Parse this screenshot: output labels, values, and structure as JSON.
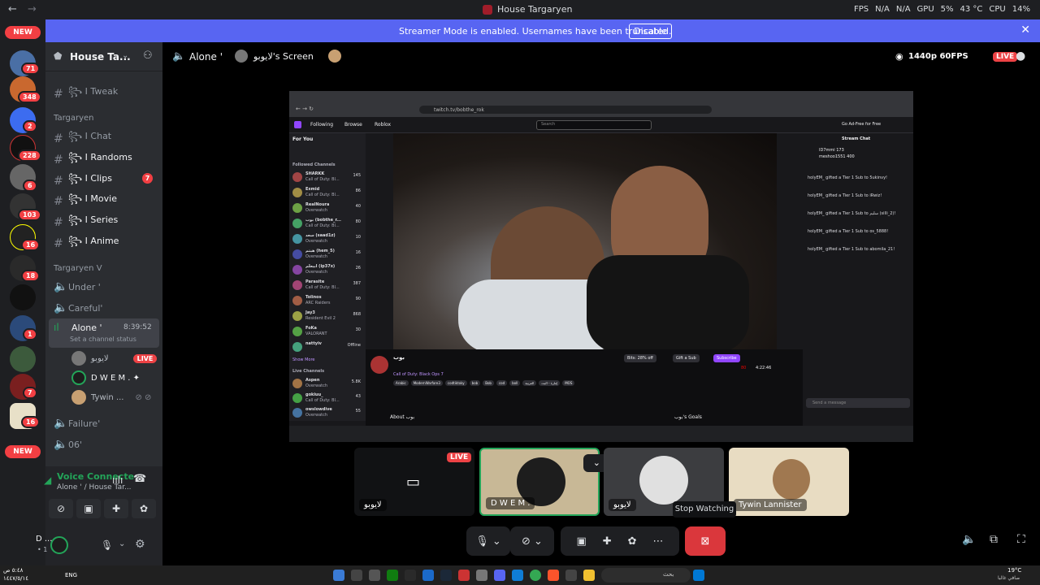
{
  "window": {
    "title": "House Targaryen"
  },
  "stats": {
    "fps_label": "FPS",
    "fps": "N/A",
    "fps2": "N/A",
    "gpu_label": "GPU",
    "gpu": "5%",
    "temp": "43 °C",
    "cpu_label": "CPU",
    "cpu": "14%"
  },
  "banner": {
    "text": "Streamer Mode is enabled. Usernames have been truncated.",
    "button": "Disable"
  },
  "rail": {
    "badges": [
      "71",
      "348",
      "2",
      "228",
      "6",
      "103",
      "16",
      "18",
      "1",
      "7",
      "16"
    ],
    "new_top": "NEW",
    "new_bottom": "NEW"
  },
  "sidebar": {
    "server_name": "House Ta...",
    "channels_top": [
      {
        "label": "꧂ I Tweak"
      }
    ],
    "category1": "Targaryen",
    "channels": [
      {
        "label": "꧂ I Chat"
      },
      {
        "label": "꧂ I Randoms"
      },
      {
        "label": "꧂ I Clips",
        "mentions": "7"
      },
      {
        "label": "꧂ I Movie"
      },
      {
        "label": "꧂ I Series"
      },
      {
        "label": "꧂ I Anime"
      }
    ],
    "category2": "Targaryen V",
    "voice": [
      {
        "label": "Under '"
      },
      {
        "label": "Careful'"
      },
      {
        "label": "Alone '",
        "timer": "8:39:52",
        "status": "Set a channel status"
      }
    ],
    "voice_users": [
      {
        "name": "لايوبو",
        "live": "LIVE"
      },
      {
        "name": "D W E M . ✦"
      },
      {
        "name": "Tywin ..."
      }
    ],
    "voice_after": [
      {
        "label": "Failure'"
      },
      {
        "label": "06'"
      }
    ]
  },
  "voice_panel": {
    "status": "Voice Connecte",
    "sub": "Alone ' / House Tar..."
  },
  "user_panel": {
    "name": "D ...",
    "sub": "• 1"
  },
  "stage": {
    "channel": "Alone '",
    "screen_title": "لايوبو's Screen",
    "quality": "1440p 60FPS",
    "live": "LIVE",
    "tooltip": "Stop Watching"
  },
  "twitch": {
    "url": "twitch.tv/bobthe_rok",
    "nav": [
      "Following",
      "Browse",
      "Roblox"
    ],
    "search_placeholder": "Search",
    "for_you": "For You",
    "followed": "Followed Channels",
    "ad_free": "Go Ad-Free for Free",
    "stream_chat": "Stream Chat",
    "channels": [
      {
        "name": "SHARKK",
        "game": "Call of Duty: Bl...",
        "viewers": "145"
      },
      {
        "name": "Exmid",
        "game": "Call of Duty: Bl...",
        "viewers": "86"
      },
      {
        "name": "RealNoura",
        "game": "Overwatch",
        "viewers": "40"
      },
      {
        "name": "بوب (bobthe_r...",
        "game": "Call of Duty: Bl...",
        "viewers": "80"
      },
      {
        "name": "سعد (saad1z)",
        "game": "Overwatch",
        "viewers": "10"
      },
      {
        "name": "هيثم (hem_5)",
        "game": "Overwatch",
        "viewers": "16"
      },
      {
        "name": "ابيعلم (ip37x)",
        "game": "Overwatch",
        "viewers": "26"
      },
      {
        "name": "Parasite",
        "game": "Call of Duty: Bl...",
        "viewers": "387"
      },
      {
        "name": "Tolinos",
        "game": "ARC Raiders",
        "viewers": "90"
      },
      {
        "name": "Jay3",
        "game": "Resident Evil 2",
        "viewers": "868"
      },
      {
        "name": "FoKa",
        "game": "VALORANT",
        "viewers": "30"
      },
      {
        "name": "nattyiv",
        "game": "",
        "viewers": "Offline"
      }
    ],
    "show_more": "Show More",
    "live_channels": "Live Channels",
    "live_list": [
      {
        "name": "Aspen",
        "game": "Overwatch",
        "viewers": "5.8K"
      },
      {
        "name": "gokiuu_",
        "game": "Call of Duty: Bl...",
        "viewers": "43"
      },
      {
        "name": "owslowdive",
        "game": "Overwatch",
        "viewers": "55"
      }
    ],
    "streamer": "بوب",
    "game": "Call of Duty: Black Ops 7",
    "tags": [
      "Arabic",
      "ModernWarfare3",
      "codtiktoky",
      "bob",
      "Bob",
      "cod",
      "boll",
      "العربية",
      "إمارة - البث",
      "MOS"
    ],
    "bits": "Bits: 28% off",
    "gift": "Gift a Sub",
    "subscribe": "Subscribe",
    "viewers": "80",
    "uptime": "4:22:46",
    "about": "About بوب",
    "goals": "بوب's Goals",
    "send_placeholder": "Send a message",
    "chat": [
      "holyEM_ gifted a Tier 1 Sub to 5ukinvy!",
      "holyEM_ gifted a Tier 1 Sub to iRwiz!",
      "holyEM_ gifted a Tier 1 Sub to سليم (silli_2)!",
      "holyEM_ gifted a Tier 1 Sub to os_5888!",
      "holyEM_ gifted a Tier 1 Sub to abomila_21!"
    ],
    "top_chat": [
      "ID7mmi  173",
      "meshoo1551  400"
    ]
  },
  "tiles": [
    {
      "label": "لايوبو",
      "live": "LIVE"
    },
    {
      "label": "D W E M ."
    },
    {
      "label": "لايوبو"
    },
    {
      "label": "Tywin Lannister"
    }
  ],
  "taskbar": {
    "lang": "ENG",
    "search": "بحث",
    "weather": "19°C",
    "weather_sub": "صافي غالبا",
    "time_left": "٥:٤٨ ص",
    "date_left": "١٤٤٧/٥/١٤"
  }
}
